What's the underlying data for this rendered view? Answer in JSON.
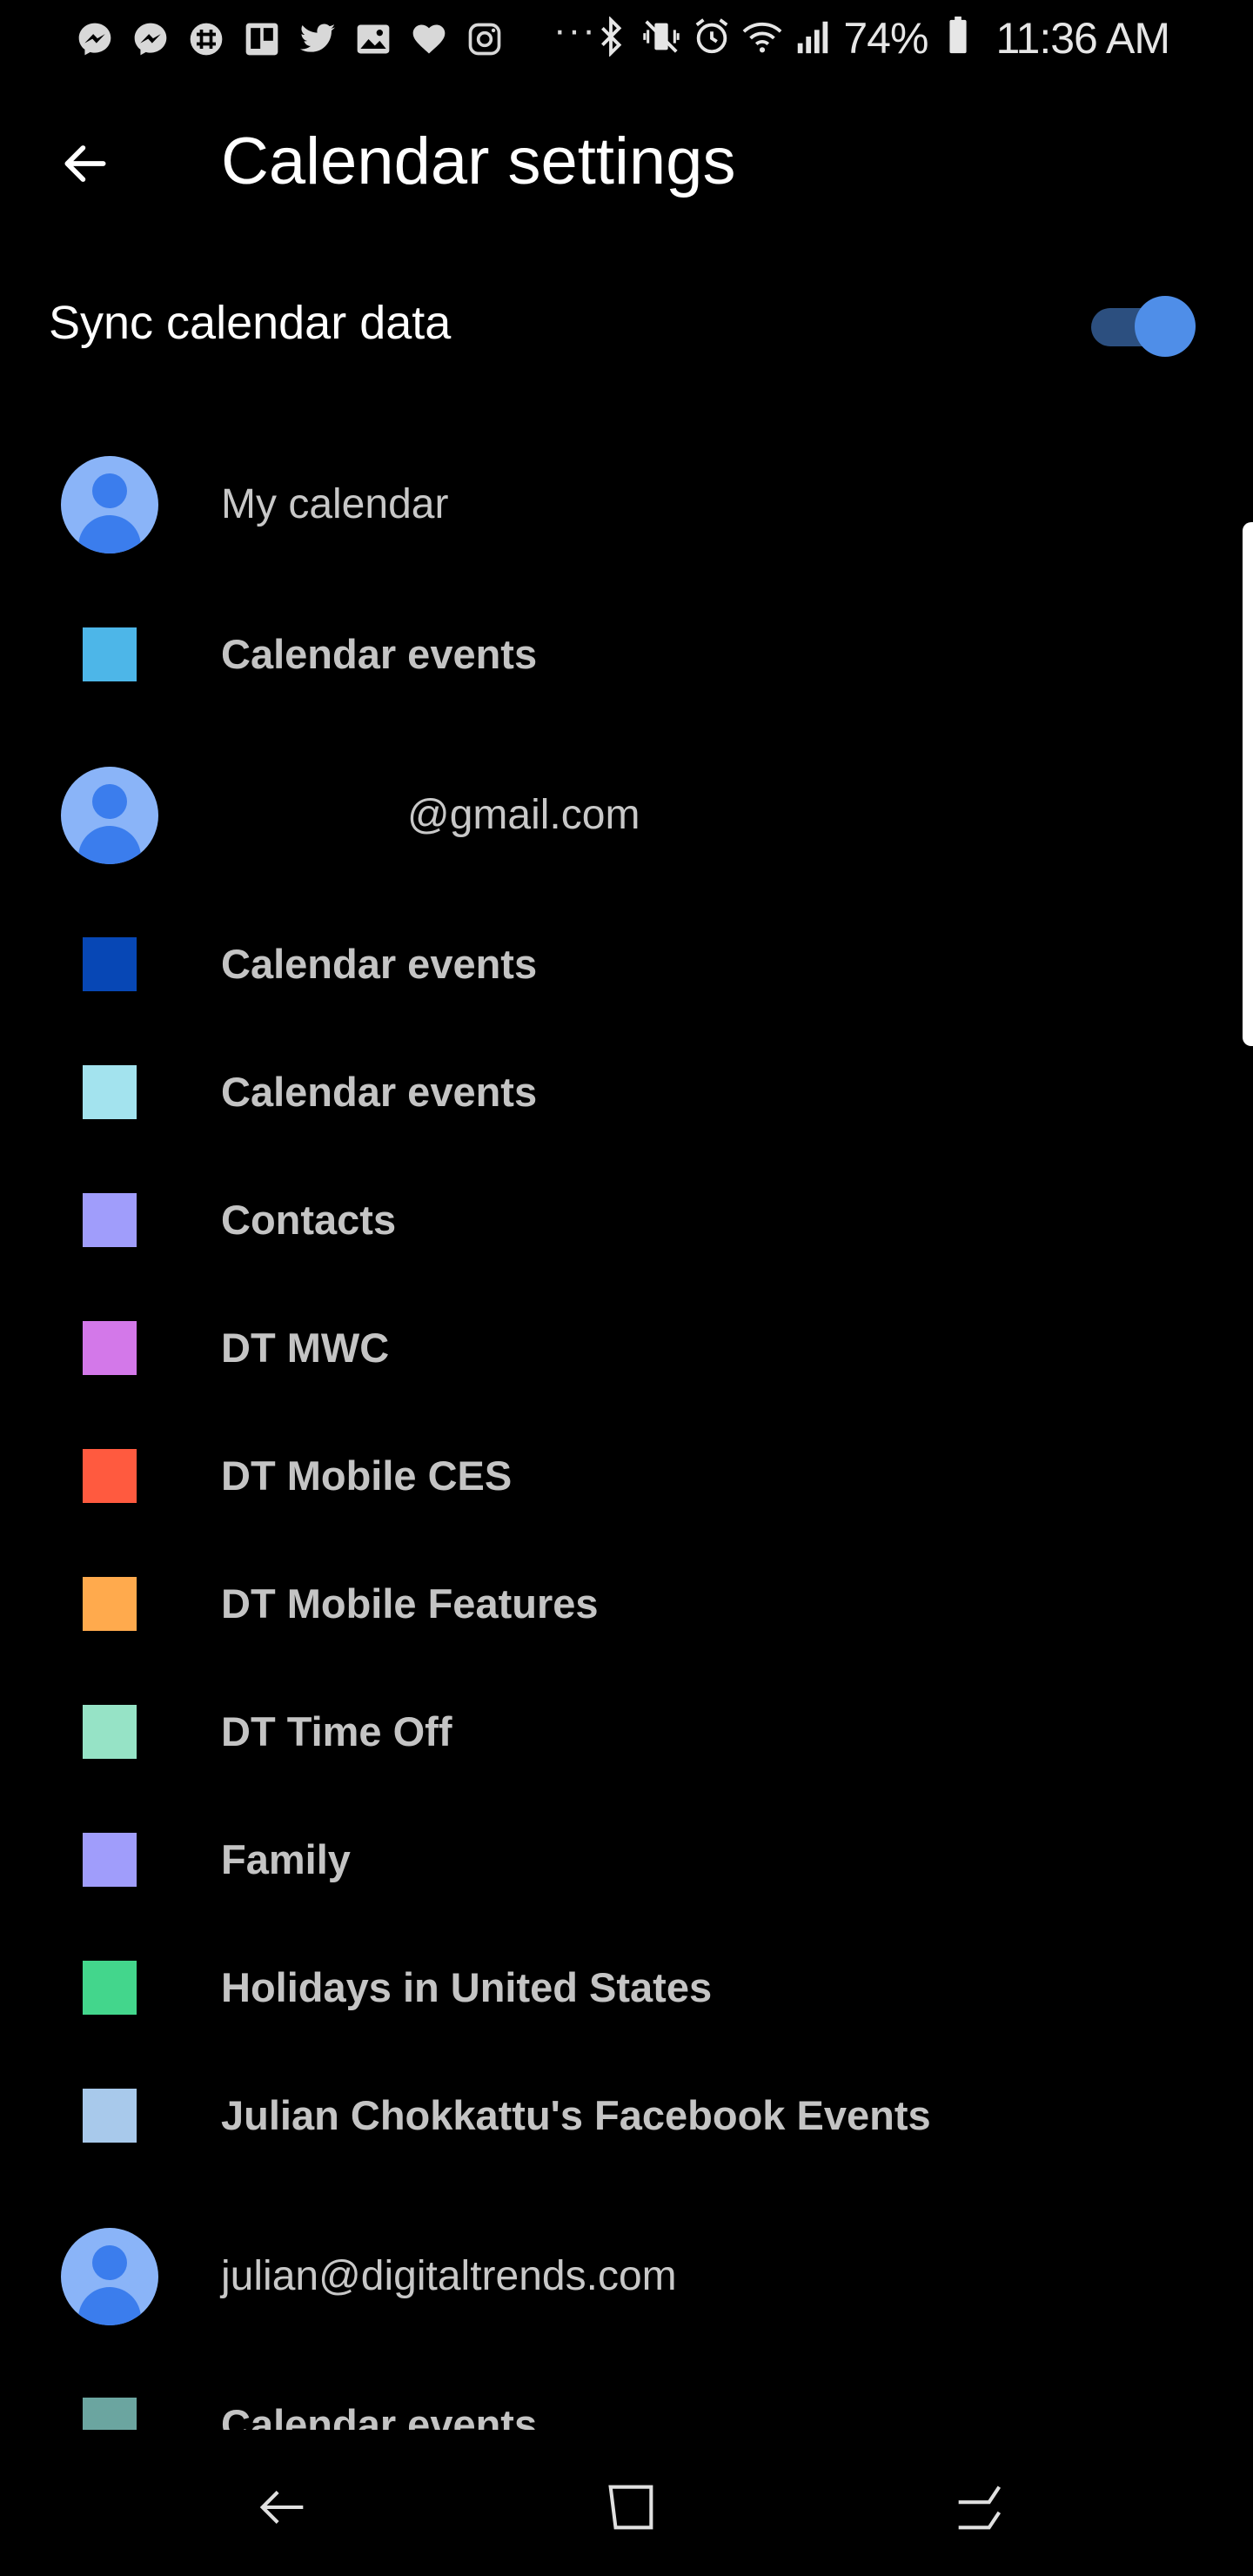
{
  "status_bar": {
    "battery_percent": "74%",
    "time": "11:36 AM",
    "overflow": "···",
    "left_icons": [
      "messenger-icon",
      "messenger-icon",
      "slack-icon",
      "trello-icon",
      "twitter-icon",
      "gallery-icon",
      "heart-icon",
      "instagram-icon"
    ],
    "right_icons": [
      "bluetooth-icon",
      "vibrate-icon",
      "alarm-icon",
      "wifi-icon",
      "signal-icon",
      "battery-icon"
    ]
  },
  "header": {
    "title": "Calendar settings"
  },
  "sync": {
    "label": "Sync calendar data",
    "enabled": true
  },
  "accounts": [
    {
      "label": "My calendar",
      "calendars": [
        {
          "label": "Calendar events",
          "color": "#4db6e8"
        }
      ]
    },
    {
      "label": "@gmail.com",
      "calendars": [
        {
          "label": "Calendar events",
          "color": "#0747b5"
        },
        {
          "label": "Calendar events",
          "color": "#a3e3ee"
        },
        {
          "label": "Contacts",
          "color": "#a09dfb"
        },
        {
          "label": "DT MWC",
          "color": "#d378e9"
        },
        {
          "label": "DT Mobile CES",
          "color": "#ff5a3f"
        },
        {
          "label": "DT Mobile Features",
          "color": "#ffaa4d"
        },
        {
          "label": "DT Time Off",
          "color": "#96e3c6"
        },
        {
          "label": "Family",
          "color": "#a09dfb"
        },
        {
          "label": "Holidays in United States",
          "color": "#43d68c"
        },
        {
          "label": "Julian Chokkattu's Facebook Events",
          "color": "#a8c9eb"
        }
      ]
    },
    {
      "label": "julian@digitaltrends.com",
      "calendars": [
        {
          "label": "Calendar events",
          "color": "#6ba5a0"
        }
      ]
    }
  ],
  "colors": {
    "background": "#000000",
    "toggle_on": "#4f8ee8",
    "toggle_track": "#2c4f7f",
    "avatar_bg": "#8ab4f8",
    "avatar_fg": "#3b7ded"
  }
}
